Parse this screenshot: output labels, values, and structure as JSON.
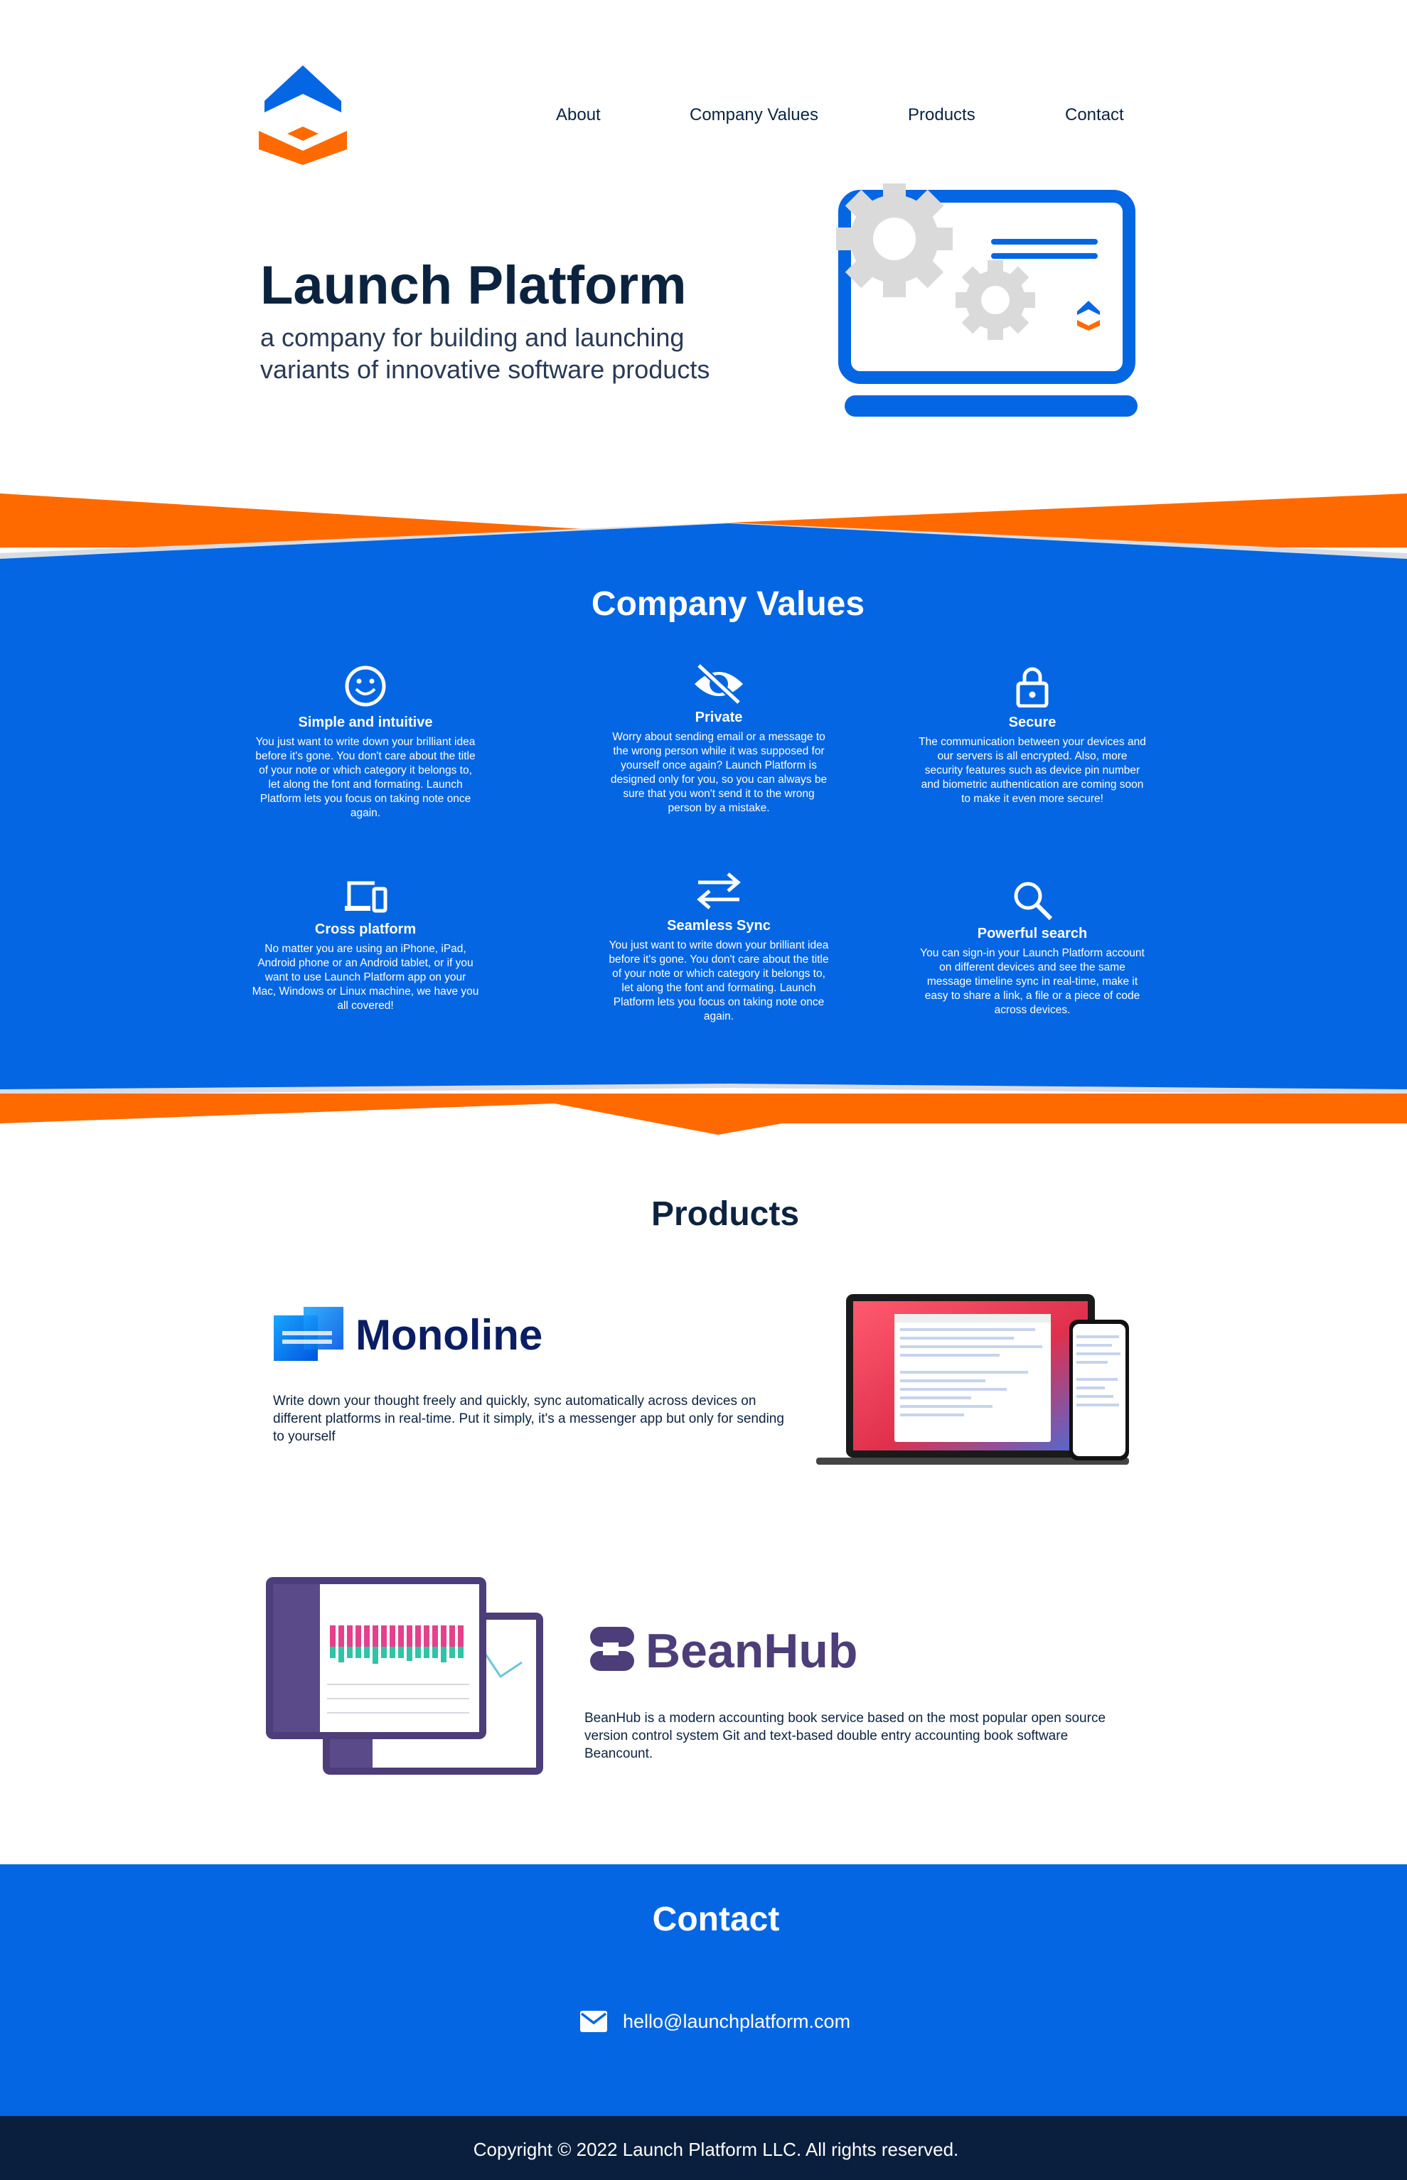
{
  "nav": {
    "items": [
      {
        "label": "About"
      },
      {
        "label": "Company Values"
      },
      {
        "label": "Products"
      },
      {
        "label": "Contact"
      }
    ]
  },
  "hero": {
    "title": "Launch Platform",
    "subtitle_line1": "a company for building and launching",
    "subtitle_line2": "variants of innovative software products"
  },
  "values": {
    "title": "Company Values",
    "items": [
      {
        "icon": "smiley-icon",
        "title": "Simple and intuitive",
        "text": "You just want to write down your brilliant idea before it's gone. You don't care about the title of your note or which category it belongs to, let along the font and formating. Launch Platform lets you focus on taking note once again."
      },
      {
        "icon": "eye-off-icon",
        "title": "Private",
        "text": "Worry about sending email or a message to the wrong person while it was supposed for yourself once again? Launch Platform is designed only for you, so you can always be sure that you won't send it to the wrong person by a mistake."
      },
      {
        "icon": "lock-icon",
        "title": "Secure",
        "text": "The communication between your devices and our servers is all encrypted. Also, more security features such as device pin number and biometric authentication are coming soon to make it even more secure!"
      },
      {
        "icon": "devices-icon",
        "title": "Cross platform",
        "text": "No matter you are using an iPhone, iPad, Android phone or an Android tablet, or if you want to use Launch Platform app on your Mac, Windows or Linux machine, we have you all covered!"
      },
      {
        "icon": "sync-arrows-icon",
        "title": "Seamless Sync",
        "text": "You just want to write down your brilliant idea before it's gone. You don't care about the title of your note or which category it belongs to, let along the font and formating. Launch Platform lets you focus on taking note once again."
      },
      {
        "icon": "search-icon",
        "title": "Powerful search",
        "text": "You can sign-in your Launch Platform account on different devices and see the same message timeline sync in real-time, make it easy to share a link, a file or a piece of code across devices."
      }
    ]
  },
  "products": {
    "title": "Products",
    "monoline": {
      "name": "Monoline",
      "description": "Write down your thought freely and quickly, sync automatically across devices on different platforms in real-time. Put it simply, it's a messenger app but only for sending to yourself"
    },
    "beanhub": {
      "name": "BeanHub",
      "description": "BeanHub is a modern accounting book service based on the most popular open source version control system Git and text-based double entry accounting book software Beancount."
    }
  },
  "contact": {
    "title": "Contact",
    "email": "hello@launchplatform.com"
  },
  "footer": {
    "copyright": "Copyright © 2022 Launch Platform LLC. All rights reserved."
  },
  "colors": {
    "blue": "#0466e2",
    "orange": "#ff6a00",
    "navy": "#0c2340",
    "footer": "#0a1f3d"
  }
}
